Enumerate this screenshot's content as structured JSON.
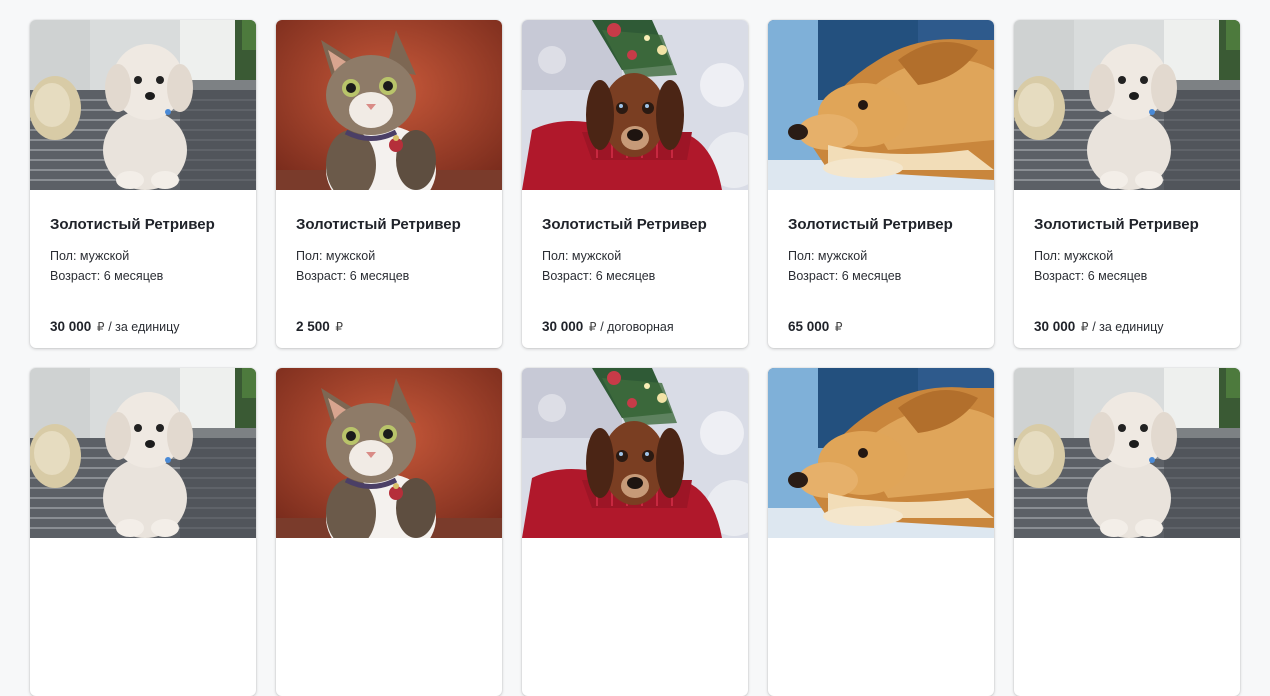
{
  "cards": [
    {
      "image": "poodle-on-armchair",
      "title": "Золотистый Ретривер",
      "sex": "Пол: мужской",
      "age": "Возраст: 6 месяцев",
      "price": "30 000",
      "currency": "₽",
      "unit": "/ за единицу"
    },
    {
      "image": "tabby-cat",
      "title": "Золотистый Ретривер",
      "sex": "Пол: мужской",
      "age": "Возраст: 6 месяцев",
      "price": "2 500",
      "currency": "₽",
      "unit": ""
    },
    {
      "image": "dachshund-red-sweater",
      "title": "Золотистый Ретривер",
      "sex": "Пол: мужской",
      "age": "Возраст: 6 месяцев",
      "price": "30 000",
      "currency": "₽",
      "unit": "/ договорная"
    },
    {
      "image": "golden-retriever-lying",
      "title": "Золотистый Ретривер",
      "sex": "Пол: мужской",
      "age": "Возраст: 6 месяцев",
      "price": "65 000",
      "currency": "₽",
      "unit": ""
    },
    {
      "image": "poodle-on-armchair",
      "title": "Золотистый Ретривер",
      "sex": "Пол: мужской",
      "age": "Возраст: 6 месяцев",
      "price": "30 000",
      "currency": "₽",
      "unit": "/ за единицу"
    },
    {
      "image": "poodle-on-armchair"
    },
    {
      "image": "tabby-cat"
    },
    {
      "image": "dachshund-red-sweater"
    },
    {
      "image": "golden-retriever-lying"
    },
    {
      "image": "poodle-on-armchair"
    }
  ]
}
